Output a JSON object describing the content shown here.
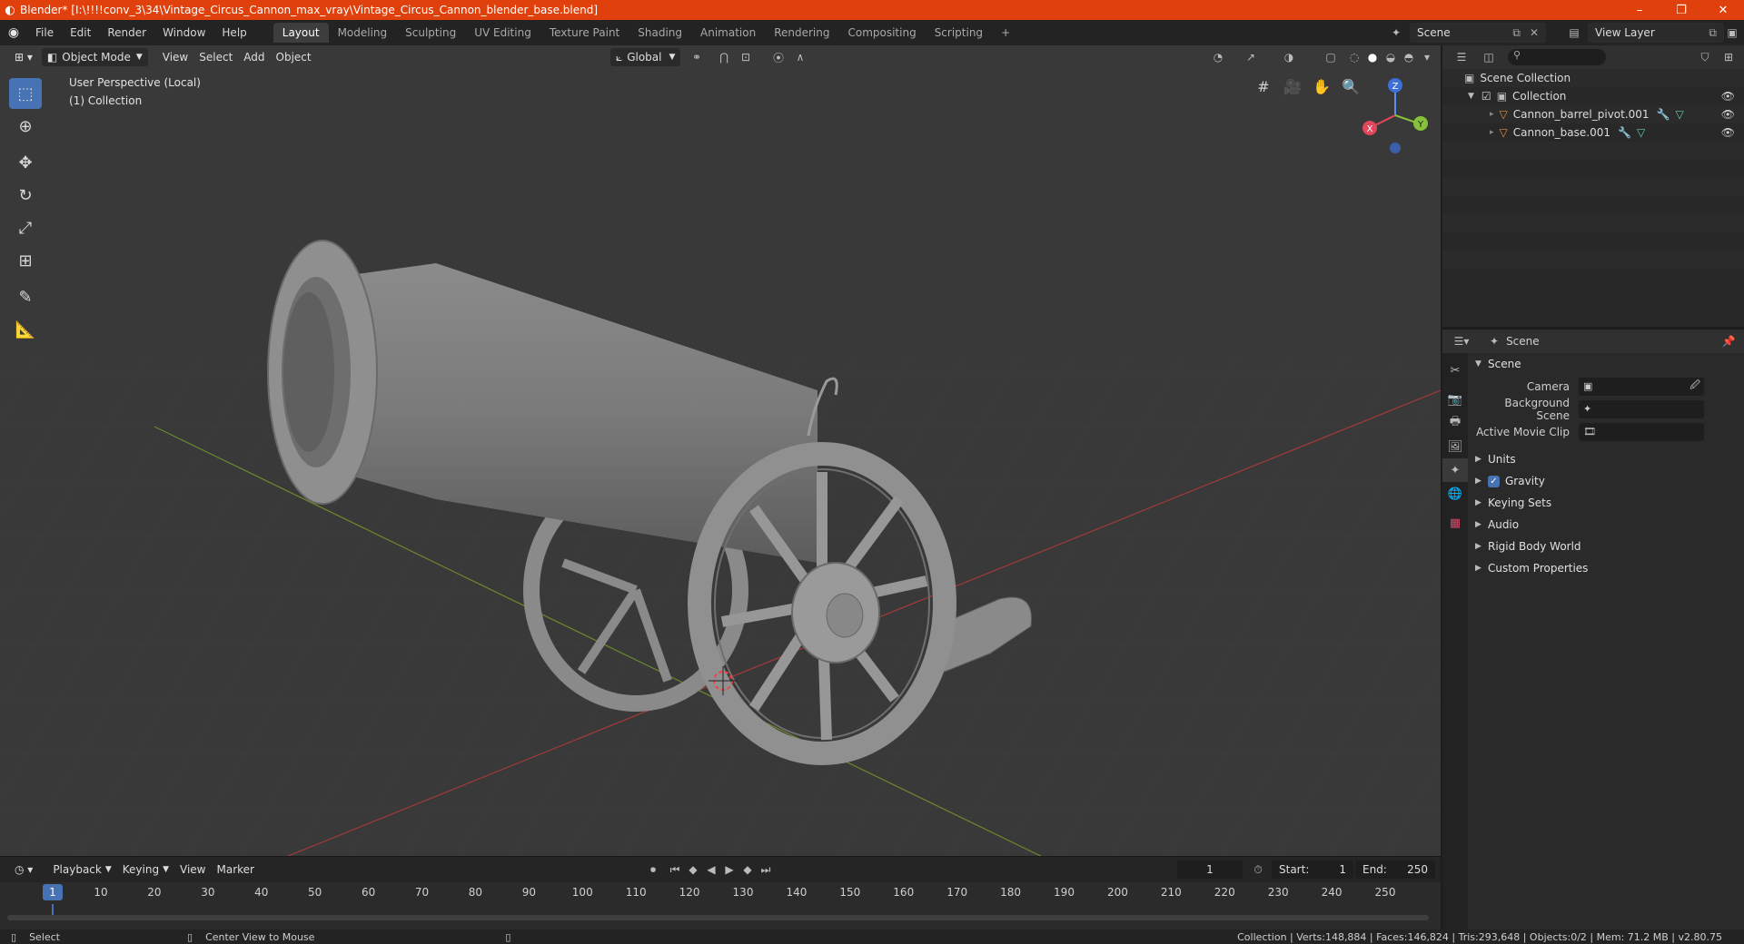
{
  "window": {
    "title": "Blender* [I:\\!!!!conv_3\\34\\Vintage_Circus_Cannon_max_vray\\Vintage_Circus_Cannon_blender_base.blend]",
    "minimize": "–",
    "maximize": "❐",
    "close": "✕"
  },
  "menu": [
    "File",
    "Edit",
    "Render",
    "Window",
    "Help"
  ],
  "workspaces": [
    "Layout",
    "Modeling",
    "Sculpting",
    "UV Editing",
    "Texture Paint",
    "Shading",
    "Animation",
    "Rendering",
    "Compositing",
    "Scripting"
  ],
  "workspace_add": "+",
  "scene_field": "Scene",
  "view_layer_field": "View Layer",
  "viewport": {
    "mode": "Object Mode",
    "menus": [
      "View",
      "Select",
      "Add",
      "Object"
    ],
    "transform_orientation": "Global",
    "perspective_label": "User Perspective (Local)",
    "collection_label": "(1) Collection",
    "gizmo": {
      "x": "X",
      "y": "Y",
      "z": "Z"
    }
  },
  "timeline": {
    "menus": [
      "Playback",
      "Keying",
      "View",
      "Marker"
    ],
    "current_frame": "1",
    "start_label": "Start:",
    "start_value": "1",
    "end_label": "End:",
    "end_value": "250",
    "ticks": [
      "1",
      "10",
      "20",
      "30",
      "40",
      "50",
      "60",
      "70",
      "80",
      "90",
      "100",
      "110",
      "120",
      "130",
      "140",
      "150",
      "160",
      "170",
      "180",
      "190",
      "200",
      "210",
      "220",
      "230",
      "240",
      "250"
    ]
  },
  "statusbar": {
    "select": "Select",
    "center_view": "Center View to Mouse",
    "stats": "Collection | Verts:148,884 | Faces:146,824 | Tris:293,648 | Objects:0/2 | Mem: 71.2 MB | v2.80.75"
  },
  "outliner": {
    "scene_collection": "Scene Collection",
    "collection": "Collection",
    "objects": [
      "Cannon_barrel_pivot.001",
      "Cannon_base.001"
    ]
  },
  "properties": {
    "header": "Scene",
    "panel_scene": "Scene",
    "camera_label": "Camera",
    "background_scene_label": "Background Scene",
    "active_movie_clip_label": "Active Movie Clip",
    "collapsed_panels": [
      "Units",
      "Gravity",
      "Keying Sets",
      "Audio",
      "Rigid Body World",
      "Custom Properties"
    ],
    "gravity_checked": true
  },
  "colors": {
    "titlebar": "#e0410c",
    "accent": "#4772b3",
    "object_icon": "#e08b3b"
  }
}
